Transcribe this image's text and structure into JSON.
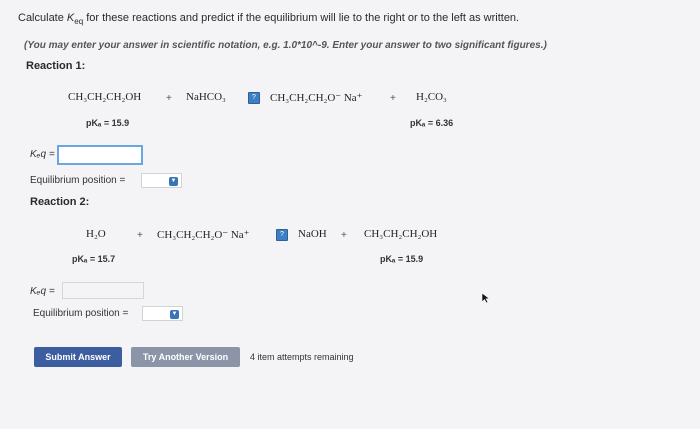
{
  "prompt": {
    "before": "Calculate ",
    "keq_k": "K",
    "keq_sub": "eq",
    "after": " for these reactions and predict if the equilibrium will lie to the right or to the left as written."
  },
  "hint": "(You may enter your answer in scientific notation, e.g. 1.0*10^-9. Enter your answer to two significant figures.)",
  "reaction1": {
    "heading": "Reaction 1:",
    "reactant1": "CH₃CH₂CH₂OH",
    "plus1": "+",
    "reactant2": "NaHCO₃",
    "eq_icon": "equilibrium-arrows-icon",
    "product1": "CH₃CH₂CH₂O⁻ Na⁺",
    "plus2": "+",
    "product2": "H₂CO₃",
    "pka_left": "pKₐ = 15.9",
    "pka_right": "pKₐ = 6.36",
    "keq_label": "Kₑq =",
    "keq_value": "",
    "position_label": "Equilibrium position =",
    "position_value": ""
  },
  "reaction2": {
    "heading": "Reaction 2:",
    "reactant1": "H₂O",
    "plus1": "+",
    "reactant2": "CH₃CH₂CH₂O⁻ Na⁺",
    "eq_icon": "equilibrium-arrows-icon",
    "product1": "NaOH",
    "plus2": "+",
    "product2": "CH₃CH₂CH₂OH",
    "pka_left": "pKₐ = 15.7",
    "pka_right": "pKₐ = 15.9",
    "keq_label": "Kₑq =",
    "keq_value": "",
    "position_label": "Equilibrium position =",
    "position_value": ""
  },
  "buttons": {
    "submit": "Submit Answer",
    "another": "Try Another Version"
  },
  "attempts": "4 item attempts remaining",
  "colors": {
    "primary_button": "#3c5ea0",
    "secondary_button": "#8c95a8",
    "input_focus": "#6aa7e2",
    "select_icon": "#3a74b8"
  }
}
